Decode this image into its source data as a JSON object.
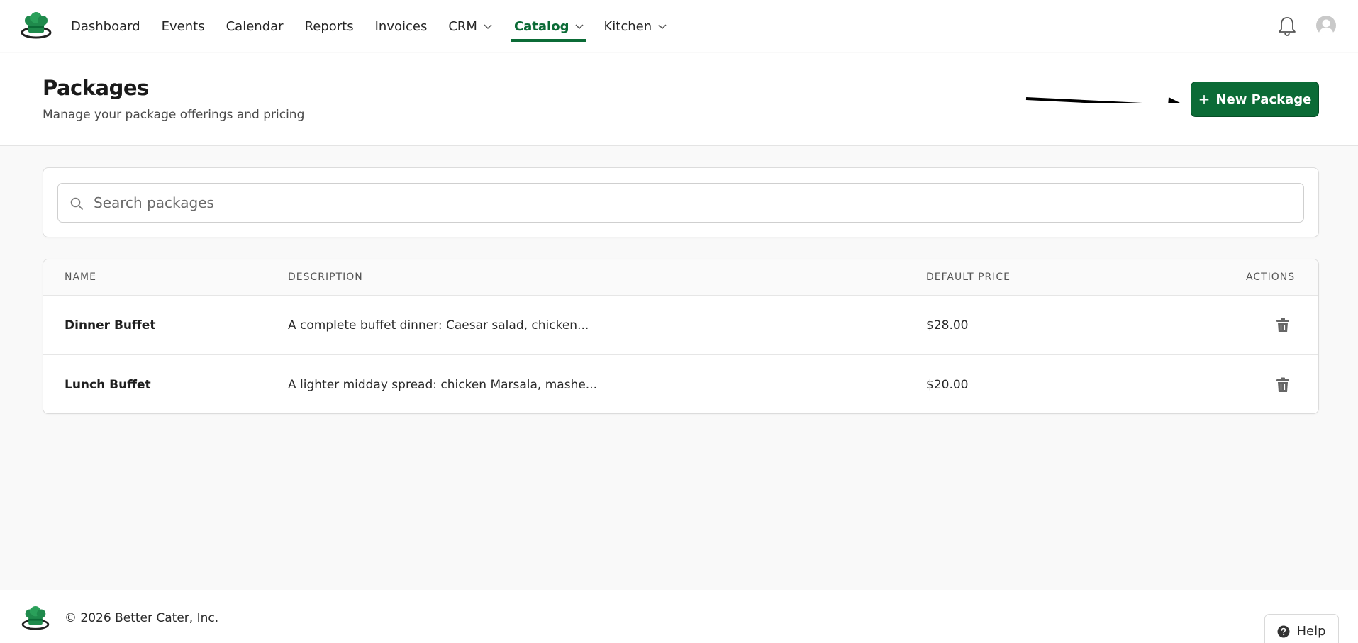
{
  "nav": {
    "items": [
      {
        "label": "Dashboard",
        "dropdown": false,
        "active": false
      },
      {
        "label": "Events",
        "dropdown": false,
        "active": false
      },
      {
        "label": "Calendar",
        "dropdown": false,
        "active": false
      },
      {
        "label": "Reports",
        "dropdown": false,
        "active": false
      },
      {
        "label": "Invoices",
        "dropdown": false,
        "active": false
      },
      {
        "label": "CRM",
        "dropdown": true,
        "active": false
      },
      {
        "label": "Catalog",
        "dropdown": true,
        "active": true
      },
      {
        "label": "Kitchen",
        "dropdown": true,
        "active": false
      }
    ],
    "icons": {
      "logo": "chef-hat-logo-icon",
      "bell": "bell-icon",
      "avatar": "user-avatar-icon"
    }
  },
  "header": {
    "title": "Packages",
    "subtitle": "Manage your package offerings and pricing",
    "new_button_label": "New Package",
    "new_button_icon": "plus-icon"
  },
  "search": {
    "placeholder": "Search packages",
    "value": ""
  },
  "table": {
    "columns": [
      "NAME",
      "DESCRIPTION",
      "DEFAULT PRICE",
      "ACTIONS"
    ],
    "rows": [
      {
        "name": "Dinner Buffet",
        "description": "A complete buffet dinner: Caesar salad, chicken...",
        "price": "$28.00",
        "action_icon": "trash-icon"
      },
      {
        "name": "Lunch Buffet",
        "description": "A lighter midday spread: chicken Marsala, mashe...",
        "price": "$20.00",
        "action_icon": "trash-icon"
      }
    ]
  },
  "footer": {
    "copyright": "© 2026 Better Cater, Inc.",
    "help_label": "Help"
  },
  "colors": {
    "brand": "#0b6b36",
    "page_bg": "#f9f9f9",
    "card_bg": "#ffffff"
  }
}
